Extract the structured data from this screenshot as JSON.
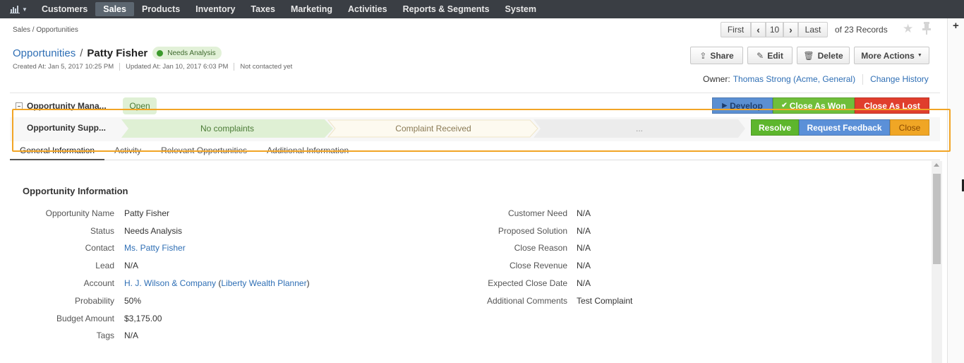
{
  "nav": {
    "logo_icon": "bar-chart-icon",
    "items": [
      "Customers",
      "Sales",
      "Products",
      "Inventory",
      "Taxes",
      "Marketing",
      "Activities",
      "Reports & Segments",
      "System"
    ],
    "active": "Sales"
  },
  "breadcrumb": "Sales / Opportunities",
  "pager": {
    "first": "First",
    "page": "10",
    "last": "Last",
    "total": "of 23 Records"
  },
  "title": {
    "section": "Opportunities",
    "separator": "/",
    "name": "Patty Fisher",
    "status": "Needs Analysis"
  },
  "meta": {
    "created": "Created At: Jan 5, 2017 10:25 PM",
    "updated": "Updated At: Jan 10, 2017 6:03 PM",
    "contacted": "Not contacted yet"
  },
  "actions": {
    "share": "Share",
    "edit": "Edit",
    "delete": "Delete",
    "more": "More Actions"
  },
  "owner": {
    "label": "Owner:",
    "name": "Thomas Strong (Acme, General)",
    "history": "Change History"
  },
  "workflow_management": {
    "label": "Opportunity Mana...",
    "step": "Open",
    "buttons": {
      "develop": "Develop",
      "won": "Close As Won",
      "lost": "Close As Lost"
    }
  },
  "workflow_support": {
    "label": "Opportunity Supp...",
    "steps": [
      "No complaints",
      "Complaint Received",
      "..."
    ],
    "buttons": {
      "resolve": "Resolve",
      "feedback": "Request Feedback",
      "close": "Close"
    }
  },
  "tabs": [
    "General Information",
    "Activity",
    "Relevant Opportunities",
    "Additional Information"
  ],
  "section_title": "Opportunity Information",
  "left_fields": [
    {
      "label": "Opportunity Name",
      "value": "Patty Fisher"
    },
    {
      "label": "Status",
      "value": "Needs Analysis"
    },
    {
      "label": "Contact",
      "value": "Ms. Patty Fisher"
    },
    {
      "label": "Lead",
      "value": "N/A"
    },
    {
      "label": "Account",
      "value": "H. J. Wilson & Company",
      "value_extra": "Liberty Wealth Planner"
    },
    {
      "label": "Probability",
      "value": "50%"
    },
    {
      "label": "Budget Amount",
      "value": "$3,175.00"
    },
    {
      "label": "Tags",
      "value": "N/A"
    }
  ],
  "right_fields": [
    {
      "label": "Customer Need",
      "value": "N/A"
    },
    {
      "label": "Proposed Solution",
      "value": "N/A"
    },
    {
      "label": "Close Reason",
      "value": "N/A"
    },
    {
      "label": "Close Revenue",
      "value": "N/A"
    },
    {
      "label": "Expected Close Date",
      "value": "N/A"
    },
    {
      "label": "Additional Comments",
      "value": "Test Complaint"
    }
  ],
  "colors": {
    "nav_bg": "#3a3e44",
    "link": "#2f6fb5",
    "highlight": "#f2a526",
    "success": "#5db62d",
    "danger": "#e03e2d"
  }
}
